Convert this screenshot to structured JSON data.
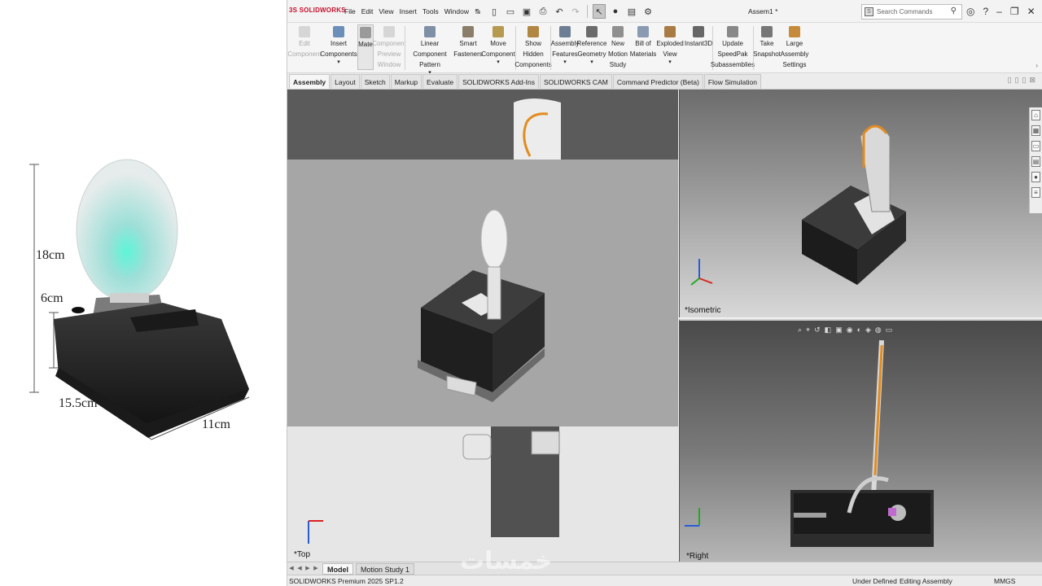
{
  "product": {
    "dimensions": {
      "height_total": "18cm",
      "height_base": "6cm",
      "length": "15.5cm",
      "width": "11cm"
    }
  },
  "app": {
    "logo": "3S SOLIDWORKS",
    "menu": [
      "File",
      "Edit",
      "View",
      "Insert",
      "Tools",
      "Window"
    ],
    "document_title": "Assem1 *",
    "search_placeholder": "Search Commands"
  },
  "ribbon": {
    "commands": [
      {
        "label": "Edit\nComponent",
        "disabled": true
      },
      {
        "label": "Insert\nComponents",
        "disabled": false
      },
      {
        "label": "Mate",
        "disabled": false,
        "selected": true
      },
      {
        "label": "Component\nPreview\nWindow",
        "disabled": true
      },
      {
        "label": "Linear Component\nPattern",
        "disabled": false
      },
      {
        "label": "Smart\nFasteners",
        "disabled": false
      },
      {
        "label": "Move\nComponent",
        "disabled": false
      },
      {
        "label": "Show\nHidden\nComponents",
        "disabled": false
      },
      {
        "label": "Assembly\nFeatures",
        "disabled": false
      },
      {
        "label": "Reference\nGeometry",
        "disabled": false
      },
      {
        "label": "New\nMotion\nStudy",
        "disabled": false
      },
      {
        "label": "Bill of\nMaterials",
        "disabled": false
      },
      {
        "label": "Exploded\nView",
        "disabled": false
      },
      {
        "label": "Instant3D",
        "disabled": false
      },
      {
        "label": "Update\nSpeedPak\nSubassemblies",
        "disabled": false
      },
      {
        "label": "Take\nSnapshot",
        "disabled": false
      },
      {
        "label": "Large\nAssembly\nSettings",
        "disabled": false
      }
    ]
  },
  "tabs": [
    "Assembly",
    "Layout",
    "Sketch",
    "Markup",
    "Evaluate",
    "SOLIDWORKS Add-Ins",
    "SOLIDWORKS CAM",
    "Command Predictor (Beta)",
    "Flow Simulation"
  ],
  "viewports": {
    "top_label": "*Top",
    "iso_label": "*Isometric",
    "right_label": "*Right"
  },
  "model_tabs": [
    "Model",
    "Motion Study 1"
  ],
  "status": {
    "product": "SOLIDWORKS Premium 2025 SP1.2",
    "definition": "Under Defined",
    "mode": "Editing Assembly",
    "units": "MMGS"
  },
  "watermark": "خمسات",
  "colors": {
    "accent_red": "#c8102e",
    "slot_orange": "#e38b1e",
    "block_dark": "#2a2a2a",
    "base_grey": "#5a5a5a",
    "disc_light": "#e8e8e8"
  }
}
